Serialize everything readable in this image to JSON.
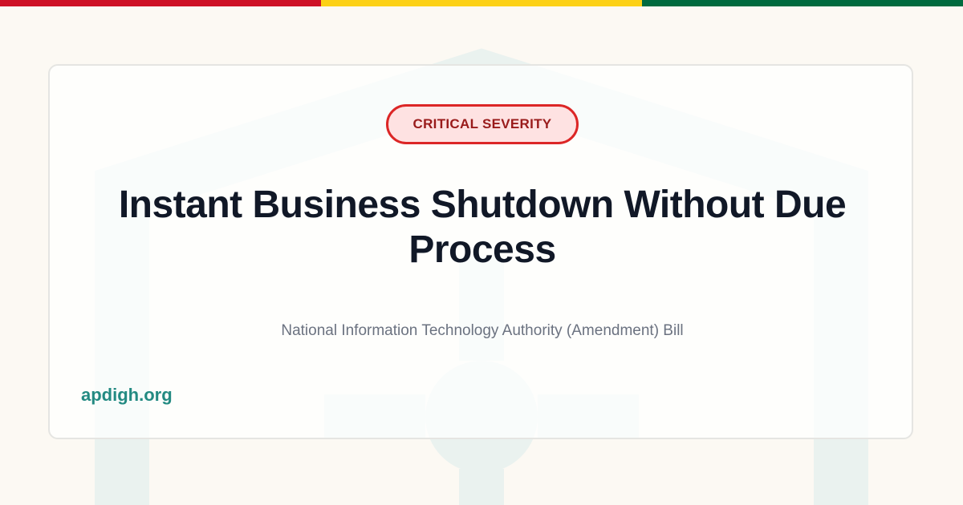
{
  "flag": {
    "colors": [
      "#ce1126",
      "#fcd116",
      "#006b3f"
    ]
  },
  "watermark": {
    "color": "#eaf2ef",
    "icon": "shield-keyhole-icon"
  },
  "badge": {
    "label": "CRITICAL SEVERITY",
    "border_color": "#dc2626",
    "bg_color": "#fee2e2",
    "text_color": "#991b1b"
  },
  "title": "Instant Business Shutdown Without Due Process",
  "subtitle": "National Information Technology Authority (Amendment) Bill",
  "site": "apdigh.org",
  "colors": {
    "accent": "#238a82",
    "title": "#111827",
    "muted": "#6b7280",
    "background": "#fcf9f3"
  }
}
